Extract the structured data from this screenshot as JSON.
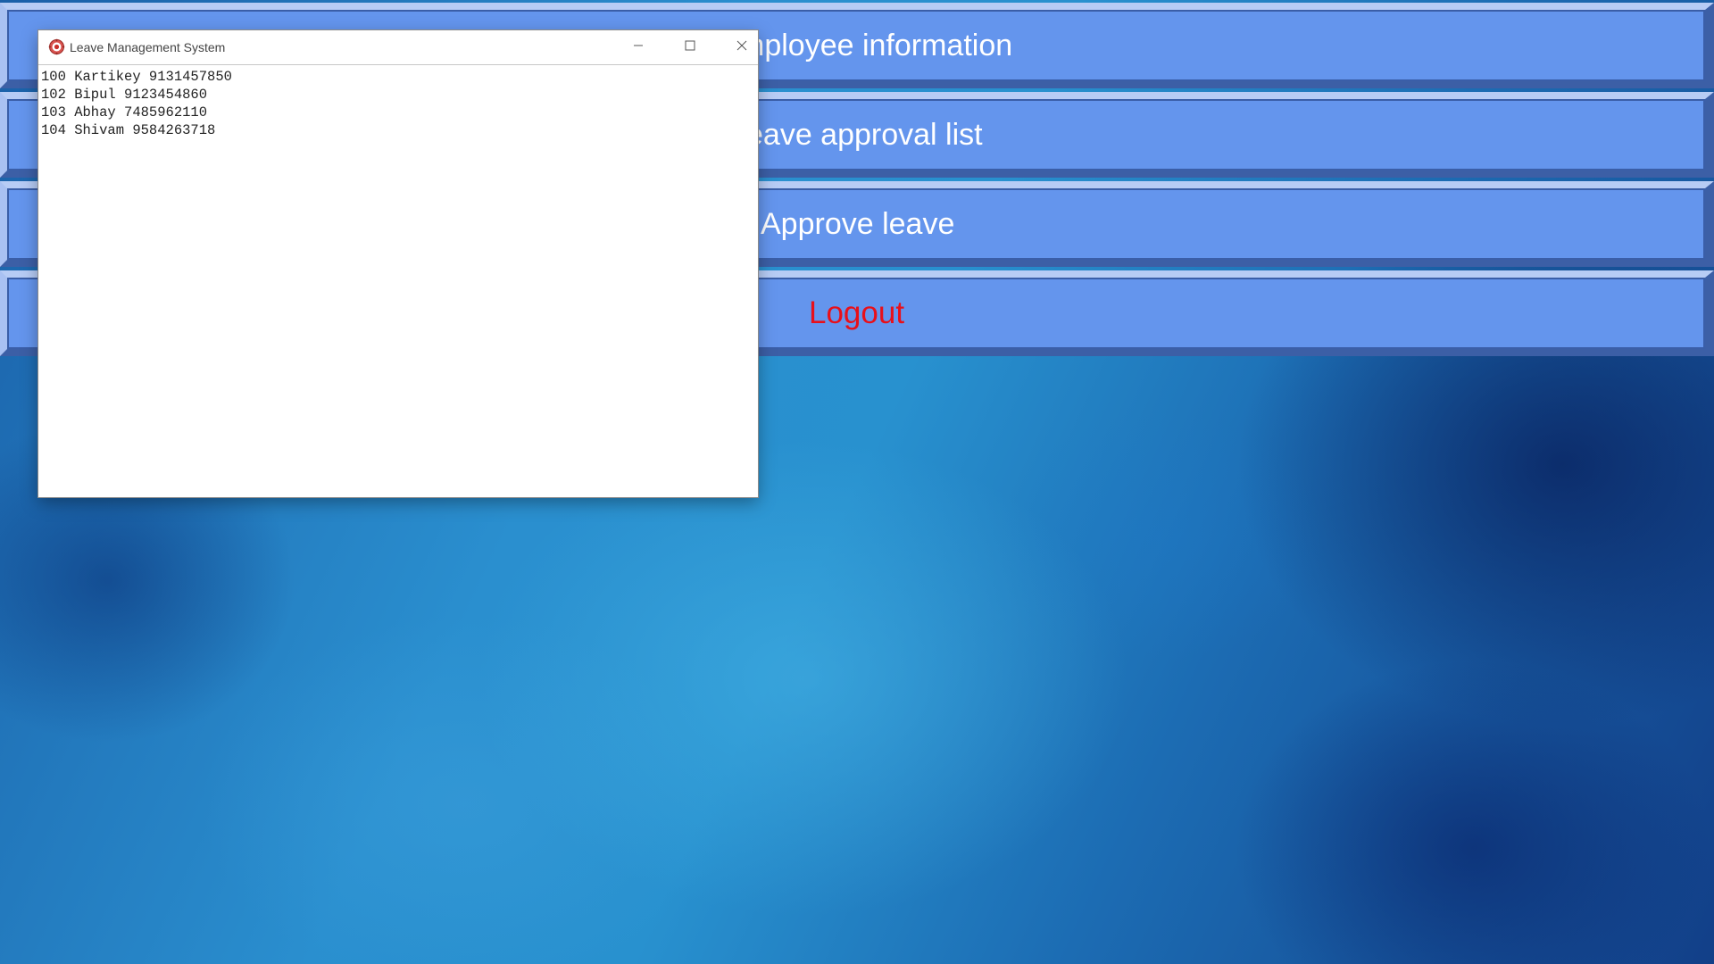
{
  "menu": {
    "employee_info_label": "mployee information",
    "leave_approval_list_label": "eave approval list",
    "approve_leave_label": "Approve leave",
    "logout_label": "Logout",
    "logout_color": "#e8101a",
    "button_color": "#6495ed"
  },
  "window": {
    "title": "Leave Management System",
    "icon": "app-gear-icon",
    "controls": [
      "minimize-icon",
      "maximize-icon",
      "close-icon"
    ]
  },
  "records": [
    {
      "text": "100 Kartikey 9131457850"
    },
    {
      "text": "102 Bipul 9123454860"
    },
    {
      "text": "103 Abhay 7485962110"
    },
    {
      "text": "104 Shivam 9584263718"
    }
  ]
}
